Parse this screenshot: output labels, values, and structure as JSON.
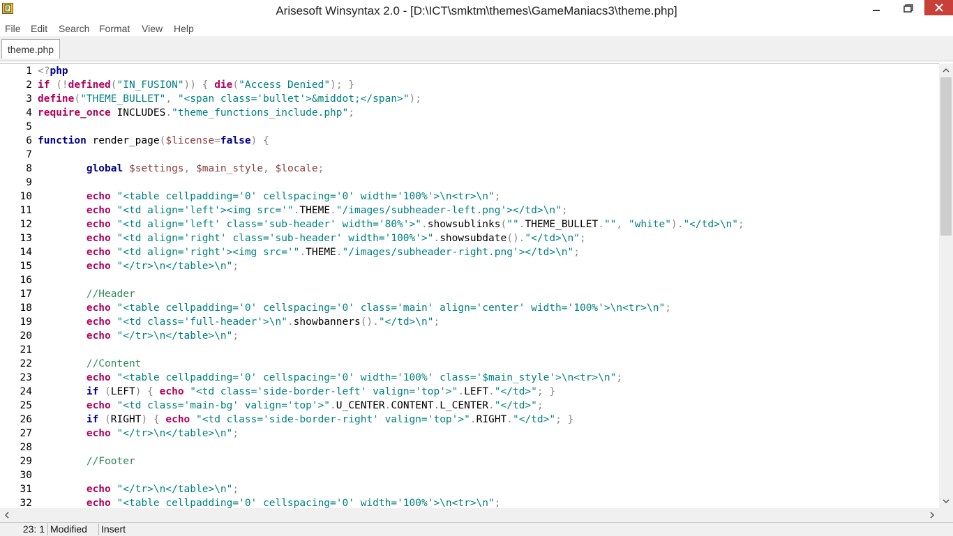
{
  "window": {
    "title": "Arisesoft Winsyntax 2.0 - [D:\\ICT\\smktm\\themes\\GameManiacs3\\theme.php]",
    "icon": "app-document-icon",
    "controls": [
      "minimize-icon",
      "maximize-icon",
      "close-icon"
    ],
    "close_color": "#c7403a"
  },
  "menu": [
    "File",
    "Edit",
    "Search",
    "Format",
    "View",
    "Help"
  ],
  "tabs": [
    {
      "label": "theme.php",
      "active": true
    }
  ],
  "editor": {
    "colors": {
      "keyword": "#b0005a",
      "string": "#008080",
      "comment": "#2e8b57",
      "variable": "#8a3d3d"
    },
    "lines": [
      {
        "n": "1",
        "tokens": [
          [
            "pun",
            "<?"
          ],
          [
            "kw2",
            "php"
          ]
        ]
      },
      {
        "n": "2",
        "tokens": [
          [
            "kw",
            "if"
          ],
          [
            "pun",
            " (!"
          ],
          [
            "kw",
            "defined"
          ],
          [
            "pun",
            "("
          ],
          [
            "str",
            "\"IN_FUSION\""
          ],
          [
            "pun",
            ")) { "
          ],
          [
            "kw",
            "die"
          ],
          [
            "pun",
            "("
          ],
          [
            "str",
            "\"Access Denied\""
          ],
          [
            "pun",
            "); }"
          ]
        ]
      },
      {
        "n": "3",
        "tokens": [
          [
            "kw",
            "define"
          ],
          [
            "pun",
            "("
          ],
          [
            "str",
            "\"THEME_BULLET\""
          ],
          [
            "pun",
            ", "
          ],
          [
            "str",
            "\"<span class='bullet'>&middot;</span>\""
          ],
          [
            "pun",
            ");"
          ]
        ]
      },
      {
        "n": "4",
        "tokens": [
          [
            "kw",
            "require_once"
          ],
          [
            "id",
            " INCLUDES"
          ],
          [
            "pun",
            "."
          ],
          [
            "str",
            "\"theme_functions_include.php\""
          ],
          [
            "pun",
            ";"
          ]
        ]
      },
      {
        "n": "5",
        "tokens": []
      },
      {
        "n": "6",
        "tokens": [
          [
            "kw2",
            "function"
          ],
          [
            "id",
            " render_page"
          ],
          [
            "pun",
            "("
          ],
          [
            "var",
            "$license"
          ],
          [
            "pun",
            "="
          ],
          [
            "kw2",
            "false"
          ],
          [
            "pun",
            ") {"
          ]
        ]
      },
      {
        "n": "7",
        "tokens": []
      },
      {
        "n": "8",
        "tokens": [
          [
            "id",
            "        "
          ],
          [
            "kw2",
            "global"
          ],
          [
            "id",
            " "
          ],
          [
            "var",
            "$settings"
          ],
          [
            "pun",
            ", "
          ],
          [
            "var",
            "$main_style"
          ],
          [
            "pun",
            ", "
          ],
          [
            "var",
            "$locale"
          ],
          [
            "pun",
            ";"
          ]
        ]
      },
      {
        "n": "9",
        "tokens": []
      },
      {
        "n": "10",
        "tokens": [
          [
            "id",
            "        "
          ],
          [
            "kw",
            "echo"
          ],
          [
            "id",
            " "
          ],
          [
            "str",
            "\"<table cellpadding='0' cellspacing='0' width='100%'>\\n<tr>\\n\""
          ],
          [
            "pun",
            ";"
          ]
        ]
      },
      {
        "n": "11",
        "tokens": [
          [
            "id",
            "        "
          ],
          [
            "kw",
            "echo"
          ],
          [
            "id",
            " "
          ],
          [
            "str",
            "\"<td align='left'><img src='\""
          ],
          [
            "pun",
            "."
          ],
          [
            "id",
            "THEME"
          ],
          [
            "pun",
            "."
          ],
          [
            "str",
            "\"/images/subheader-left.png'></td>\\n\""
          ],
          [
            "pun",
            ";"
          ]
        ]
      },
      {
        "n": "12",
        "tokens": [
          [
            "id",
            "        "
          ],
          [
            "kw",
            "echo"
          ],
          [
            "id",
            " "
          ],
          [
            "str",
            "\"<td align='left' class='sub-header' width='80%'>\""
          ],
          [
            "pun",
            "."
          ],
          [
            "id",
            "showsublinks"
          ],
          [
            "pun",
            "("
          ],
          [
            "str",
            "\"\""
          ],
          [
            "pun",
            "."
          ],
          [
            "id",
            "THEME_BULLET"
          ],
          [
            "pun",
            "."
          ],
          [
            "str",
            "\"\""
          ],
          [
            "pun",
            ", "
          ],
          [
            "str",
            "\"white\""
          ],
          [
            "pun",
            ")."
          ],
          [
            "str",
            "\"</td>\\n\""
          ],
          [
            "pun",
            ";"
          ]
        ]
      },
      {
        "n": "13",
        "tokens": [
          [
            "id",
            "        "
          ],
          [
            "kw",
            "echo"
          ],
          [
            "id",
            " "
          ],
          [
            "str",
            "\"<td align='right' class='sub-header' width='100%'>\""
          ],
          [
            "pun",
            "."
          ],
          [
            "id",
            "showsubdate"
          ],
          [
            "pun",
            "()."
          ],
          [
            "str",
            "\"</td>\\n\""
          ],
          [
            "pun",
            ";"
          ]
        ]
      },
      {
        "n": "14",
        "tokens": [
          [
            "id",
            "        "
          ],
          [
            "kw",
            "echo"
          ],
          [
            "id",
            " "
          ],
          [
            "str",
            "\"<td align='right'><img src='\""
          ],
          [
            "pun",
            "."
          ],
          [
            "id",
            "THEME"
          ],
          [
            "pun",
            "."
          ],
          [
            "str",
            "\"/images/subheader-right.png'></td>\\n\""
          ],
          [
            "pun",
            ";"
          ]
        ]
      },
      {
        "n": "15",
        "tokens": [
          [
            "id",
            "        "
          ],
          [
            "kw",
            "echo"
          ],
          [
            "id",
            " "
          ],
          [
            "str",
            "\"</tr>\\n</table>\\n\""
          ],
          [
            "pun",
            ";"
          ]
        ]
      },
      {
        "n": "16",
        "tokens": []
      },
      {
        "n": "17",
        "tokens": [
          [
            "id",
            "        "
          ],
          [
            "com",
            "//Header"
          ]
        ]
      },
      {
        "n": "18",
        "tokens": [
          [
            "id",
            "        "
          ],
          [
            "kw",
            "echo"
          ],
          [
            "id",
            " "
          ],
          [
            "str",
            "\"<table cellpadding='0' cellspacing='0' class='main' align='center' width='100%'>\\n<tr>\\n\""
          ],
          [
            "pun",
            ";"
          ]
        ]
      },
      {
        "n": "19",
        "tokens": [
          [
            "id",
            "        "
          ],
          [
            "kw",
            "echo"
          ],
          [
            "id",
            " "
          ],
          [
            "str",
            "\"<td class='full-header'>\\n\""
          ],
          [
            "pun",
            "."
          ],
          [
            "id",
            "showbanners"
          ],
          [
            "pun",
            "()."
          ],
          [
            "str",
            "\"</td>\\n\""
          ],
          [
            "pun",
            ";"
          ]
        ]
      },
      {
        "n": "20",
        "tokens": [
          [
            "id",
            "        "
          ],
          [
            "kw",
            "echo"
          ],
          [
            "id",
            " "
          ],
          [
            "str",
            "\"</tr>\\n</table>\\n\""
          ],
          [
            "pun",
            ";"
          ]
        ]
      },
      {
        "n": "21",
        "tokens": []
      },
      {
        "n": "22",
        "tokens": [
          [
            "id",
            "        "
          ],
          [
            "com",
            "//Content"
          ]
        ]
      },
      {
        "n": "23",
        "tokens": [
          [
            "id",
            "        "
          ],
          [
            "kw",
            "echo"
          ],
          [
            "id",
            " "
          ],
          [
            "str",
            "\"<table cellpadding='0' cellspacing='0' width='100%' class='$main_style'>\\n<tr>\\n\""
          ],
          [
            "pun",
            ";"
          ]
        ]
      },
      {
        "n": "24",
        "tokens": [
          [
            "id",
            "        "
          ],
          [
            "kw2",
            "if"
          ],
          [
            "pun",
            " ("
          ],
          [
            "id",
            "LEFT"
          ],
          [
            "pun",
            ") { "
          ],
          [
            "kw",
            "echo"
          ],
          [
            "id",
            " "
          ],
          [
            "str",
            "\"<td class='side-border-left' valign='top'>\""
          ],
          [
            "pun",
            "."
          ],
          [
            "id",
            "LEFT"
          ],
          [
            "pun",
            "."
          ],
          [
            "str",
            "\"</td>\""
          ],
          [
            "pun",
            "; }"
          ]
        ]
      },
      {
        "n": "25",
        "tokens": [
          [
            "id",
            "        "
          ],
          [
            "kw",
            "echo"
          ],
          [
            "id",
            " "
          ],
          [
            "str",
            "\"<td class='main-bg' valign='top'>\""
          ],
          [
            "pun",
            "."
          ],
          [
            "id",
            "U_CENTER"
          ],
          [
            "pun",
            "."
          ],
          [
            "id",
            "CONTENT"
          ],
          [
            "pun",
            "."
          ],
          [
            "id",
            "L_CENTER"
          ],
          [
            "pun",
            "."
          ],
          [
            "str",
            "\"</td>\""
          ],
          [
            "pun",
            ";"
          ]
        ]
      },
      {
        "n": "26",
        "tokens": [
          [
            "id",
            "        "
          ],
          [
            "kw2",
            "if"
          ],
          [
            "pun",
            " ("
          ],
          [
            "id",
            "RIGHT"
          ],
          [
            "pun",
            ") { "
          ],
          [
            "kw",
            "echo"
          ],
          [
            "id",
            " "
          ],
          [
            "str",
            "\"<td class='side-border-right' valign='top'>\""
          ],
          [
            "pun",
            "."
          ],
          [
            "id",
            "RIGHT"
          ],
          [
            "pun",
            "."
          ],
          [
            "str",
            "\"</td>\""
          ],
          [
            "pun",
            "; }"
          ]
        ]
      },
      {
        "n": "27",
        "tokens": [
          [
            "id",
            "        "
          ],
          [
            "kw",
            "echo"
          ],
          [
            "id",
            " "
          ],
          [
            "str",
            "\"</tr>\\n</table>\\n\""
          ],
          [
            "pun",
            ";"
          ]
        ]
      },
      {
        "n": "28",
        "tokens": []
      },
      {
        "n": "29",
        "tokens": [
          [
            "id",
            "        "
          ],
          [
            "com",
            "//Footer"
          ]
        ]
      },
      {
        "n": "30",
        "tokens": []
      },
      {
        "n": "31",
        "tokens": [
          [
            "id",
            "        "
          ],
          [
            "kw",
            "echo"
          ],
          [
            "id",
            " "
          ],
          [
            "str",
            "\"</tr>\\n</table>\\n\""
          ],
          [
            "pun",
            ";"
          ]
        ]
      },
      {
        "n": "32",
        "tokens": [
          [
            "id",
            "        "
          ],
          [
            "kw",
            "echo"
          ],
          [
            "id",
            " "
          ],
          [
            "str",
            "\"<table cellpadding='0' cellspacing='0' width='100%'>\\n<tr>\\n\""
          ],
          [
            "pun",
            ";"
          ]
        ]
      }
    ]
  },
  "status": {
    "position": "23:  1",
    "modified": "Modified",
    "mode": "Insert"
  }
}
